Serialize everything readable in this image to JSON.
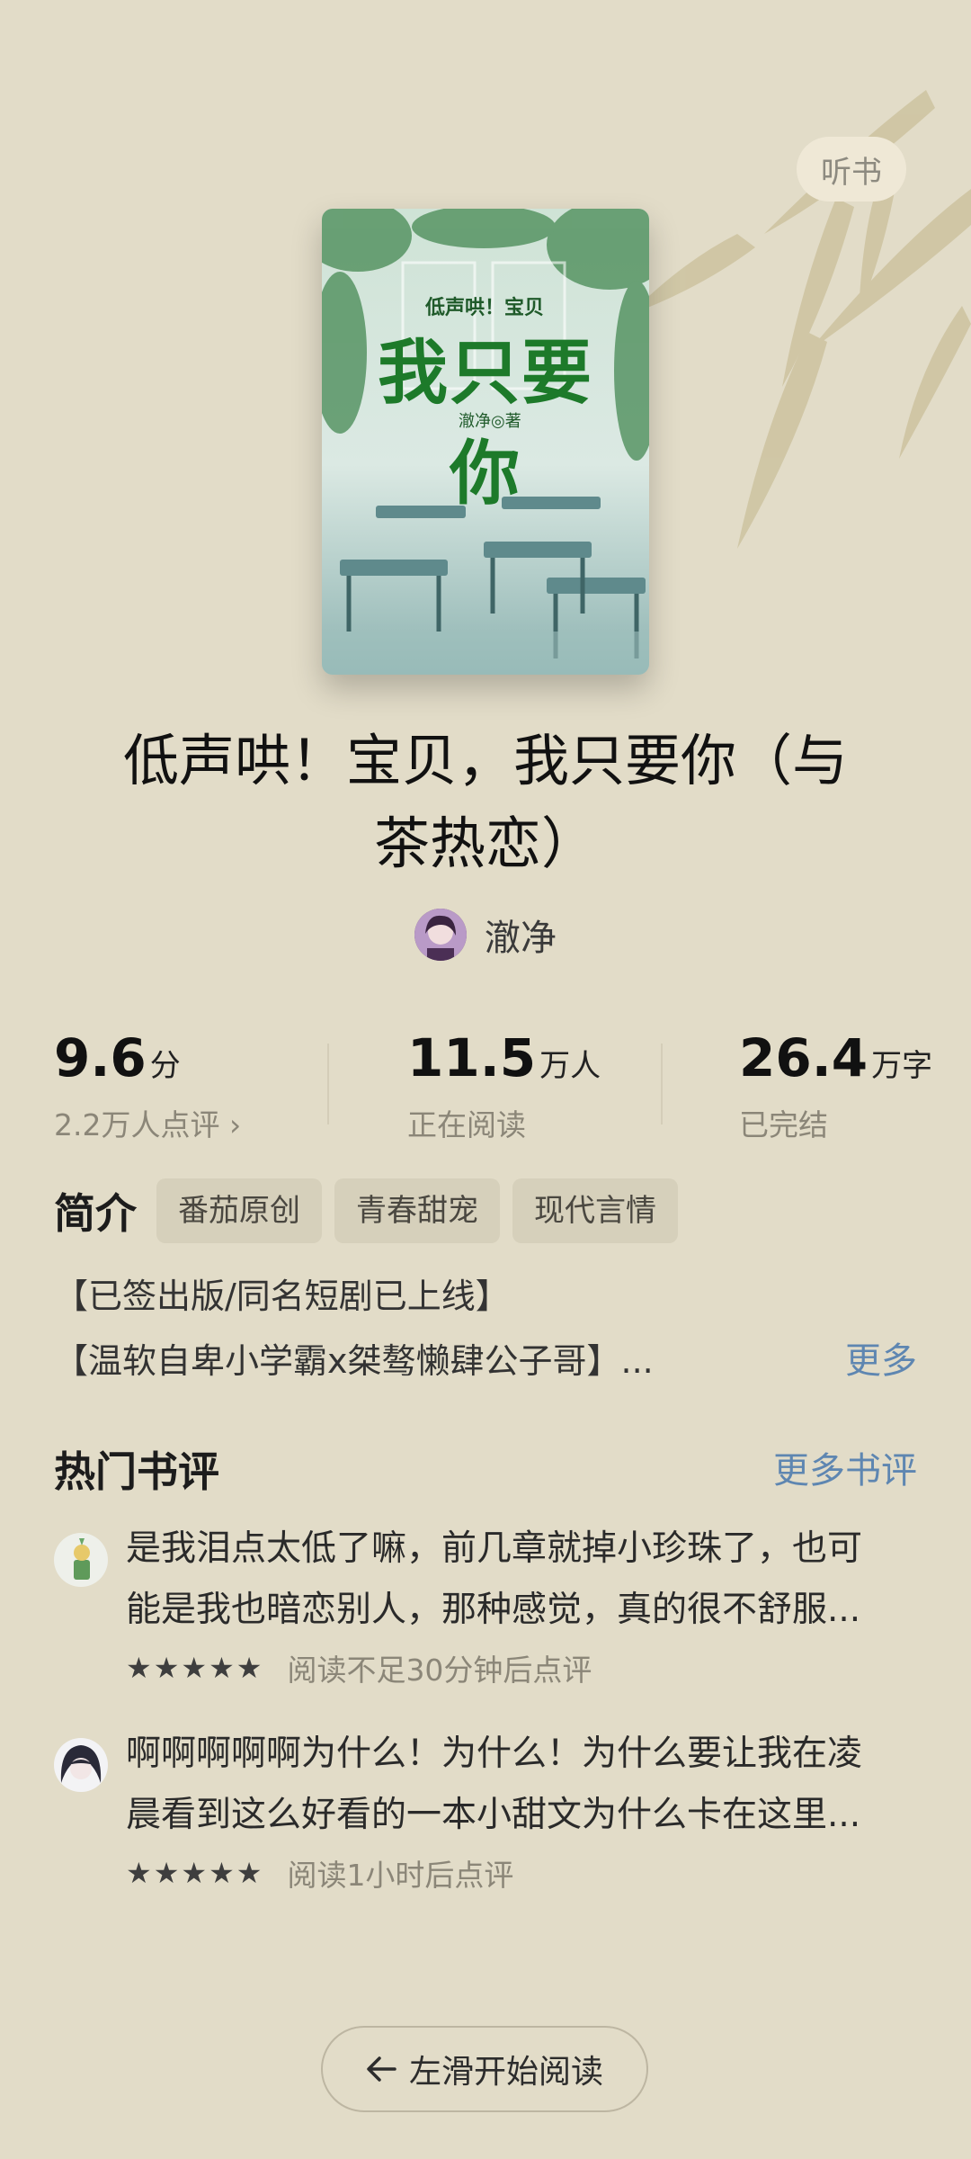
{
  "header": {
    "listen_label": "听书"
  },
  "cover": {
    "sub_title": "低声哄！宝贝",
    "main_title": "我只要你",
    "author_mark": "澈净◎著"
  },
  "book": {
    "title_line1": "低声哄！宝贝，我只要你（与",
    "title_line2": "茶热恋）",
    "author": "澈净"
  },
  "stats": {
    "score": {
      "value": "9.6",
      "unit": "分",
      "sub": "2.2万人点评 ›"
    },
    "readers": {
      "value": "11.5",
      "unit": "万人",
      "sub": "正在阅读"
    },
    "words": {
      "value": "26.4",
      "unit": "万字",
      "sub": "已完结"
    }
  },
  "intro": {
    "label": "简介",
    "tags": [
      "番茄原创",
      "青春甜宠",
      "现代言情"
    ],
    "line1": "【已签出版/同名短剧已上线】",
    "line2": "【温软自卑小学霸x桀骜懒肆公子哥】...",
    "more": "更多"
  },
  "reviews": {
    "title": "热门书评",
    "more": "更多书评",
    "items": [
      {
        "line1": "是我泪点太低了嘛，前几章就掉小珍珠了，也可",
        "line2": "能是我也暗恋别人，那种感觉，真的很不舒服...",
        "stars": "★★★★★",
        "rating": 5,
        "time": "阅读不足30分钟后点评",
        "avatar_icon": "plant-avatar-icon"
      },
      {
        "line1": "啊啊啊啊啊为什么！为什么！为什么要让我在凌",
        "line2": "晨看到这么好看的一本小甜文为什么卡在这里...",
        "stars": "★★★★★",
        "rating": 5,
        "time": "阅读1小时后点评",
        "avatar_icon": "anime-avatar-icon"
      }
    ]
  },
  "footer": {
    "start_label": "左滑开始阅读",
    "arrow_icon": "arrow-left-icon"
  },
  "colors": {
    "background": "#e2dcc8",
    "link": "#5e86b1",
    "muted": "#8b8678"
  }
}
